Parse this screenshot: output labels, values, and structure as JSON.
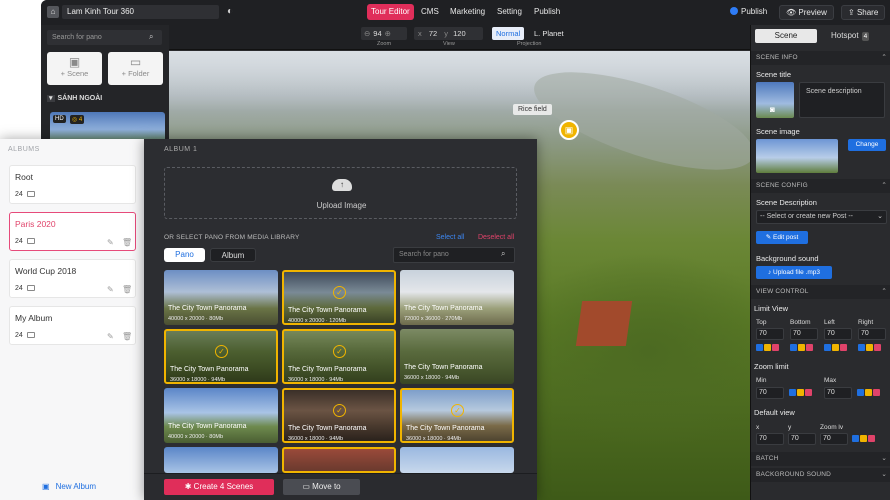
{
  "topbar": {
    "tour_name": "Lam Kinh Tour 360",
    "nav": [
      "Tour Editor",
      "CMS",
      "Marketing",
      "Setting",
      "Publish"
    ],
    "publish_toggle": "Publish",
    "preview": "Preview",
    "share": "Share"
  },
  "controls": {
    "zoom_value": "94",
    "zoom_label": "Zoom",
    "view_x_prefix": "x",
    "view_x": "72",
    "view_y_prefix": "y",
    "view_y": "120",
    "view_label": "View",
    "proj_normal": "Normal",
    "proj_planet": "L. Planet",
    "proj_label": "Projection"
  },
  "scene_sidebar": {
    "search_placeholder": "Search for pano",
    "add_scene": "+ Scene",
    "add_folder": "+ Folder",
    "group": "SÁNH NGOÀI",
    "hd_badge": "HD",
    "hotspot_count": "4"
  },
  "pano": {
    "hotspot_label": "Rice field"
  },
  "inspector": {
    "tab_scene": "Scene",
    "tab_hotspot": "Hotspot",
    "hotspot_count": "4",
    "scene_info": "SCENE INFO",
    "scene_title": "Scene title",
    "scene_description_ph": "Scene description",
    "scene_image": "Scene image",
    "change": "Change",
    "scene_config": "SCENE CONFIG",
    "scene_description": "Scene Description",
    "select_post_ph": "-- Select or create new Post --",
    "edit_post": "Edit post",
    "background_sound": "Background sound",
    "upload_file": "Upload file .mp3",
    "view_control": "VIEW CONTROL",
    "limit_view": "Limit View",
    "limits": [
      {
        "label": "Top",
        "value": "70"
      },
      {
        "label": "Bottom",
        "value": "70"
      },
      {
        "label": "Left",
        "value": "70"
      },
      {
        "label": "Right",
        "value": "70"
      }
    ],
    "zoom_limit": "Zoom limit",
    "zoom_limits": [
      {
        "label": "Min",
        "value": "70"
      },
      {
        "label": "Max",
        "value": "70"
      }
    ],
    "default_view": "Default view",
    "default_views": [
      {
        "label": "x",
        "value": "70"
      },
      {
        "label": "y",
        "value": "70"
      },
      {
        "label": "Zoom lv",
        "value": "70"
      }
    ],
    "batch": "BATCH",
    "bg_sound_hdr": "BACKGROUND SOUND"
  },
  "albums": {
    "header": "ALBUMS",
    "items": [
      {
        "name": "Root",
        "count": "24"
      },
      {
        "name": "Paris 2020",
        "count": "24"
      },
      {
        "name": "World Cup 2018",
        "count": "24"
      },
      {
        "name": "My Album",
        "count": "24"
      }
    ],
    "new_album": "New Album"
  },
  "album_main": {
    "header": "ALBUM 1",
    "upload": "Upload Image",
    "or_select": "OR SELECT PANO FROM MEDIA LIBRARY",
    "select_all": "Select all",
    "deselect_all": "Deselect all",
    "tab_pano": "Pano",
    "tab_album": "Album",
    "search_placeholder": "Search for pano",
    "panos": [
      {
        "title": "The City Town Panorama",
        "meta": "40000 x 20000  ·  80Mb"
      },
      {
        "title": "The City Town Panorama",
        "meta": "40000 x 20000  ·  120Mb"
      },
      {
        "title": "The City Town Panorama",
        "meta": "72000 x 36000  ·  270Mb"
      },
      {
        "title": "The City Town Panorama",
        "meta": "36000 x 18000  ·  94Mb"
      },
      {
        "title": "The City Town Panorama",
        "meta": "36000 x 18000  ·  94Mb"
      },
      {
        "title": "The City Town Panorama",
        "meta": "36000 x 18000  ·  94Mb"
      },
      {
        "title": "The City Town Panorama",
        "meta": "40000 x 20000  ·  80Mb"
      },
      {
        "title": "The City Town Panorama",
        "meta": "36000 x 18000  ·  94Mb"
      },
      {
        "title": "The City Town Panorama",
        "meta": "36000 x 18000  ·  94Mb"
      }
    ],
    "create_scenes": "Create 4 Scenes",
    "move_to": "Move to"
  },
  "colors": {
    "accent_pink": "#e02e5a",
    "accent_blue": "#1f6fe0",
    "selection_yellow": "#f0b400"
  }
}
